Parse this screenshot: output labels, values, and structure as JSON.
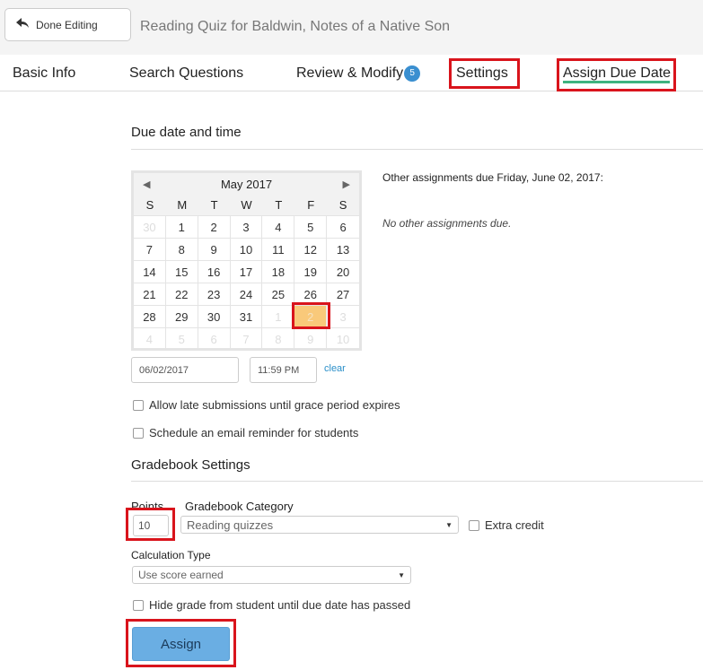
{
  "header": {
    "done_label": "Done Editing",
    "title": "Reading Quiz for Baldwin, Notes of a Native Son"
  },
  "tabs": [
    {
      "label": "Basic Info"
    },
    {
      "label": "Search Questions"
    },
    {
      "label": "Review & Modify",
      "badge": "5"
    },
    {
      "label": "Settings"
    },
    {
      "label": "Assign Due Date",
      "active": true
    }
  ],
  "due": {
    "heading": "Due date and time",
    "other_label": "Other assignments due Friday, June 02, 2017:",
    "none_label": "No other assignments due.",
    "date_value": "06/02/2017",
    "time_value": "11:59 PM",
    "clear_label": "clear",
    "late_label": "Allow late submissions until grace period expires",
    "reminder_label": "Schedule an email reminder for students"
  },
  "calendar": {
    "month": "May 2017",
    "weekdays": [
      "S",
      "M",
      "T",
      "W",
      "T",
      "F",
      "S"
    ],
    "days": [
      [
        "30",
        1
      ],
      [
        "1",
        0
      ],
      [
        "2",
        0
      ],
      [
        "3",
        0
      ],
      [
        "4",
        0
      ],
      [
        "5",
        0
      ],
      [
        "6",
        0
      ],
      [
        "7",
        0
      ],
      [
        "8",
        0
      ],
      [
        "9",
        0
      ],
      [
        "10",
        0
      ],
      [
        "11",
        0
      ],
      [
        "12",
        0
      ],
      [
        "13",
        0
      ],
      [
        "14",
        0
      ],
      [
        "15",
        0
      ],
      [
        "16",
        0
      ],
      [
        "17",
        0
      ],
      [
        "18",
        0
      ],
      [
        "19",
        0
      ],
      [
        "20",
        0
      ],
      [
        "21",
        0
      ],
      [
        "22",
        0
      ],
      [
        "23",
        0
      ],
      [
        "24",
        0
      ],
      [
        "25",
        0
      ],
      [
        "26",
        0
      ],
      [
        "27",
        0
      ],
      [
        "28",
        0
      ],
      [
        "29",
        0
      ],
      [
        "30",
        0
      ],
      [
        "31",
        0
      ],
      [
        "1",
        1
      ],
      [
        "2",
        2
      ],
      [
        "3",
        1
      ],
      [
        "4",
        1
      ],
      [
        "5",
        1
      ],
      [
        "6",
        1
      ],
      [
        "7",
        1
      ],
      [
        "8",
        1
      ],
      [
        "9",
        1
      ],
      [
        "10",
        1
      ]
    ],
    "selected": "June 2, 2017"
  },
  "gradebook": {
    "heading": "Gradebook Settings",
    "points_label": "Points",
    "points_value": "10",
    "category_label": "Gradebook Category",
    "category_value": "Reading quizzes",
    "extra_label": "Extra credit",
    "calc_label": "Calculation Type",
    "calc_value": "Use score earned",
    "hide_label": "Hide grade from student until due date has passed"
  },
  "assign_label": "Assign",
  "colors": {
    "highlight": "#d9141c",
    "active_tab": "#3fb37f",
    "selected_day": "#f9c97a",
    "button": "#6aaee3"
  }
}
